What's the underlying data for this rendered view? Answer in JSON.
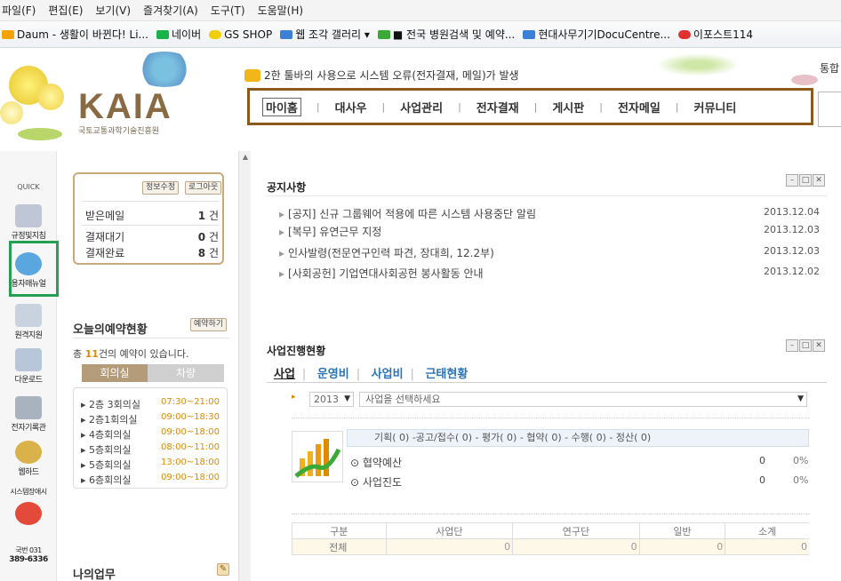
{
  "menu": [
    "파일(F)",
    "편집(E)",
    "보기(V)",
    "즐겨찾기(A)",
    "도구(T)",
    "도움말(H)"
  ],
  "favorites": [
    {
      "label": "Daum - 생활이 바뀐다! Li...",
      "color": "#f5a300"
    },
    {
      "label": "네이버",
      "color": "#18b34a"
    },
    {
      "label": "GS SHOP",
      "color": "#f0d000"
    },
    {
      "label": "웹 조각 갤러리 ▾",
      "color": "#3c7fd6"
    },
    {
      "label": "■ 전국 병원검색 및 예약...",
      "color": "#3aa935"
    },
    {
      "label": "현대사무기기DocuCentre...",
      "color": "#3c7fd6"
    },
    {
      "label": "이포스트114",
      "color": "#e03030"
    }
  ],
  "header": {
    "logo": "KAIA",
    "logo_sub": "국토교통과학기술진흥원",
    "ticker": "2한 툴바의 사용으로 시스템 오류(전자결재, 메일)가 발생",
    "right_text": "통합"
  },
  "nav": [
    "마이홈",
    "대사우",
    "사업관리",
    "전자결재",
    "게시판",
    "전자메일",
    "커뮤니티"
  ],
  "quick": {
    "title": "QUICK",
    "items": [
      {
        "label": "규정및지침",
        "color": "#bfc7d6"
      },
      {
        "label": "용자매뉴얼",
        "color": "#5aa7e0"
      },
      {
        "label": "원격지원",
        "color": "#c9d3df"
      },
      {
        "label": "다운로드",
        "color": "#b7c6d8"
      },
      {
        "label": "전자기록관",
        "color": "#a9b3bf"
      },
      {
        "label": "웹하드",
        "color": "#d9b24a"
      },
      {
        "label": "시스템장애시",
        "color": "#e34a3a"
      }
    ],
    "phone_line1": "국번 031",
    "phone_line2": "389-6336"
  },
  "userbox": {
    "btn_edit": "정보수정",
    "btn_logout": "로그아웃",
    "rows": [
      {
        "label": "받은메일",
        "count": "1",
        "unit": "건"
      },
      {
        "label": "결재대기",
        "count": "0",
        "unit": "건"
      },
      {
        "label": "결재완료",
        "count": "8",
        "unit": "건"
      }
    ]
  },
  "reservation": {
    "title": "오늘의예약현황",
    "btn": "예약하기",
    "count_prefix": "총",
    "count": "11",
    "count_suffix": "건의 예약이 있습니다.",
    "tab_active": "회의실",
    "tab_inactive": "차량",
    "rooms": [
      {
        "name": "2층 3회의실",
        "time": "07:30~21:00"
      },
      {
        "name": "2층1회의실",
        "time": "09:00~18:30"
      },
      {
        "name": "4층회의실",
        "time": "09:00~18:00"
      },
      {
        "name": "5층회의실",
        "time": "08:00~11:00"
      },
      {
        "name": "5층회의실",
        "time": "13:00~18:00"
      },
      {
        "name": "6층회의실",
        "time": "09:00~18:00"
      }
    ]
  },
  "mywork": {
    "title": "나의업무"
  },
  "notice": {
    "title": "공지사항",
    "items": [
      {
        "text": "[공지] 신규 그룹웨어 적용에 따른 시스템 사용중단 알림",
        "date": "2013.12.04"
      },
      {
        "text": "[복무] 유연근무 지정",
        "date": "2013.12.03"
      },
      {
        "text": "인사발령(전문연구인력 파견, 장대희, 12.2부)",
        "date": "2013.12.03"
      },
      {
        "text": "[사회공헌] 기업연대사회공헌 봉사활동 안내",
        "date": "2013.12.02"
      }
    ]
  },
  "project": {
    "title": "사업진행현황",
    "tabs": [
      "사업",
      "운영비",
      "사업비",
      "근태현황"
    ],
    "year": "2013",
    "select_placeholder": "사업을 선택하세요",
    "stages": "기획(  0) -공고/접수(  0) - 평가(  0) - 협약(  0) - 수행(  0) - 정산(  0)",
    "stats": [
      {
        "label": "협약예산",
        "value": "0",
        "pct": "0%"
      },
      {
        "label": "사업진도",
        "value": "0",
        "pct": "0%"
      }
    ],
    "table_headers": [
      "구분",
      "사업단",
      "연구단",
      "일반",
      "소계"
    ],
    "table_row": [
      "전체",
      "0",
      "0",
      "0",
      "0"
    ]
  }
}
